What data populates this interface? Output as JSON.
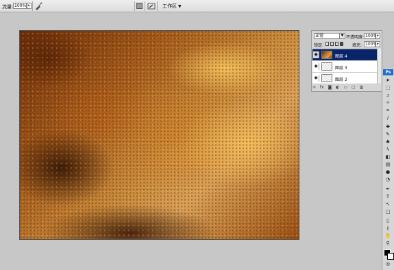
{
  "options_bar": {
    "flow_label": "流量:",
    "flow_value": "100%",
    "workspace_label": "工作区"
  },
  "layers_panel": {
    "blend_mode": "正常",
    "opacity_label": "不透明度:",
    "opacity_value": "100%",
    "lock_label": "锁定:",
    "fill_label": "填充:",
    "fill_value": "100%",
    "layers": [
      {
        "name": "图层 4",
        "selected": true,
        "visible": true
      },
      {
        "name": "图层 3",
        "selected": false,
        "visible": true
      },
      {
        "name": "图层 2",
        "selected": false,
        "visible": true
      }
    ],
    "footer_icons": [
      "link-icon",
      "fx-icon",
      "mask-icon",
      "adjustment-icon",
      "folder-icon",
      "new-layer-icon",
      "trash-icon"
    ]
  },
  "toolbox": {
    "logo": "Ps",
    "foreground_color": "#000000",
    "background_color": "#ffffff"
  },
  "colors": {
    "selected_layer": "#0a246a",
    "ps_blue": "#1d6fd6",
    "workspace_bg": "#c7c7c7"
  }
}
